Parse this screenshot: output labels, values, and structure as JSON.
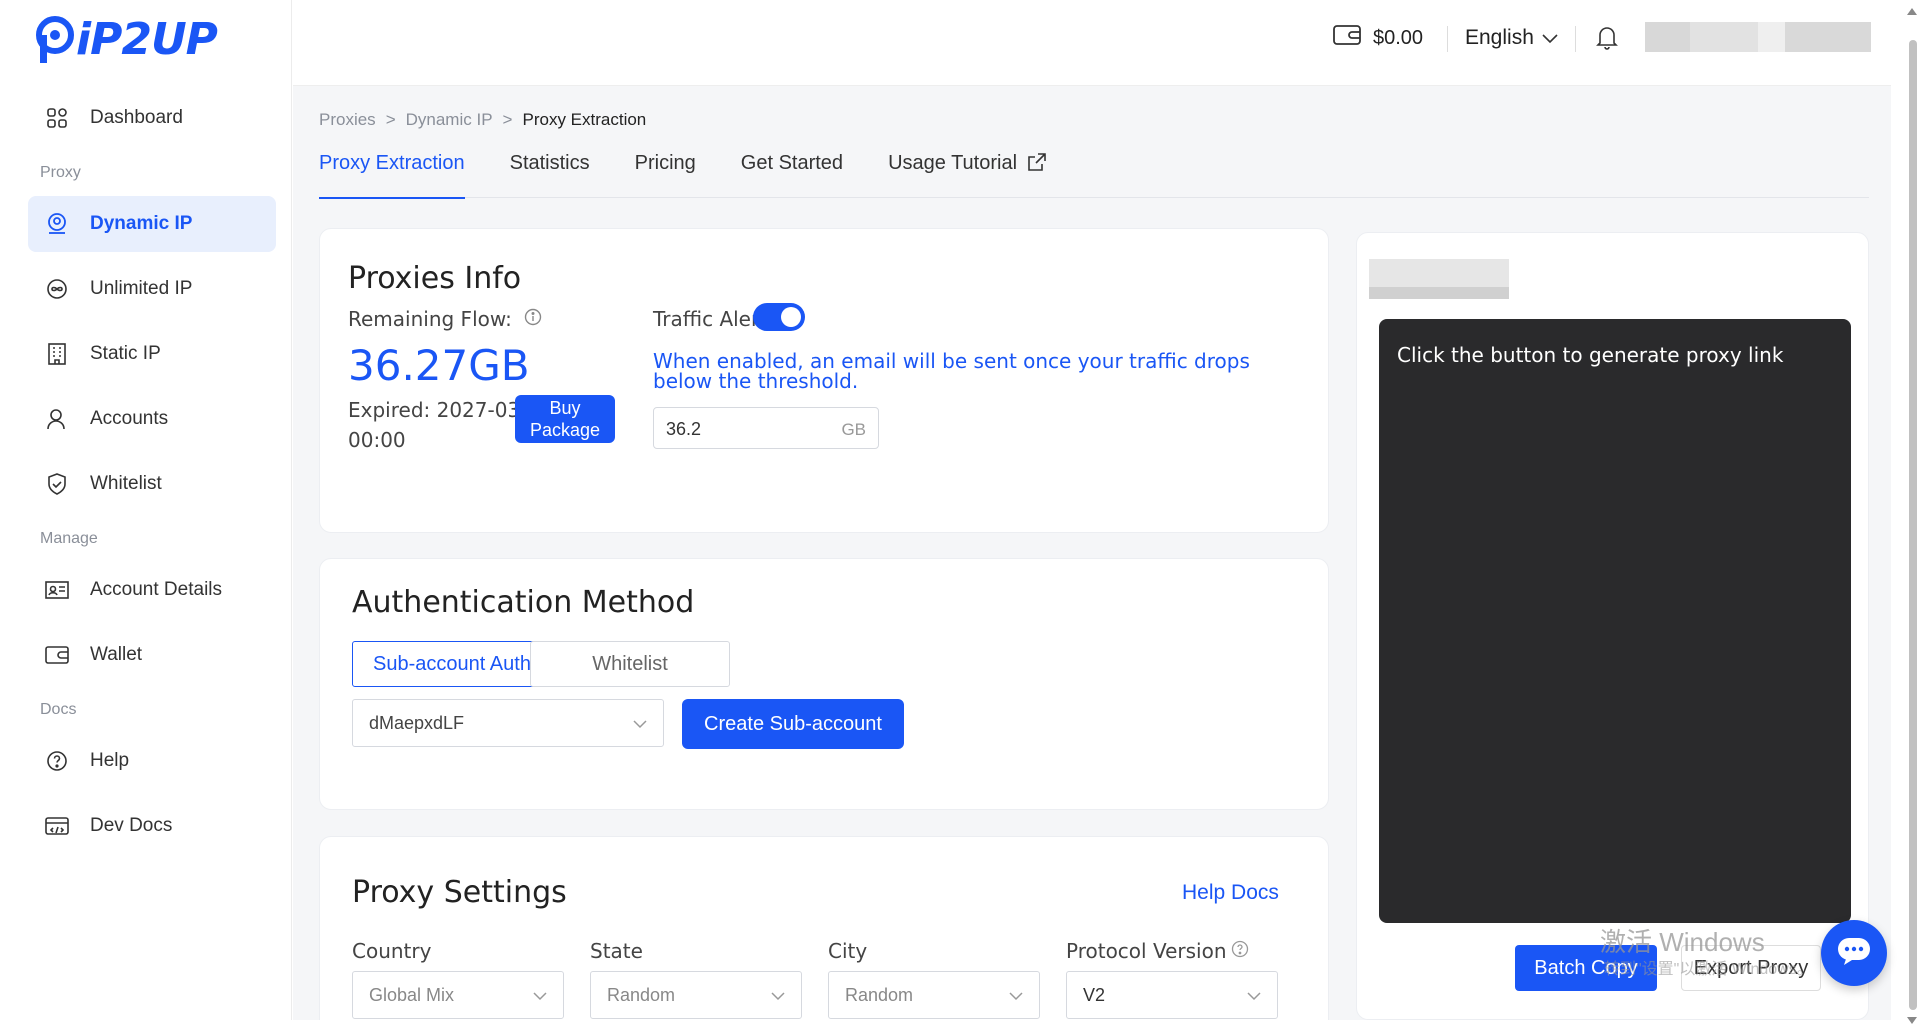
{
  "brand": {
    "logo_text": "iP2UP",
    "accent": "#1a56f5"
  },
  "sidebar": {
    "items_top": [
      {
        "label": "Dashboard",
        "icon": "dashboard-grid-icon"
      }
    ],
    "sections": [
      {
        "title": "Proxy",
        "items": [
          {
            "label": "Dynamic IP",
            "icon": "location-pin-icon",
            "active": true
          },
          {
            "label": "Unlimited IP",
            "icon": "infinity-icon"
          },
          {
            "label": "Static IP",
            "icon": "building-icon"
          },
          {
            "label": "Accounts",
            "icon": "user-icon"
          },
          {
            "label": "Whitelist",
            "icon": "shield-icon"
          }
        ]
      },
      {
        "title": "Manage",
        "items": [
          {
            "label": "Account Details",
            "icon": "id-card-icon"
          },
          {
            "label": "Wallet",
            "icon": "wallet-icon"
          }
        ]
      },
      {
        "title": "Docs",
        "items": [
          {
            "label": "Help",
            "icon": "help-circle-icon"
          },
          {
            "label": "Dev Docs",
            "icon": "code-doc-icon"
          }
        ]
      }
    ]
  },
  "topbar": {
    "balance": "$0.00",
    "language": "English"
  },
  "breadcrumb": {
    "items": [
      "Proxies",
      "Dynamic IP"
    ],
    "current": "Proxy Extraction",
    "sep": ">"
  },
  "tabs": [
    {
      "label": "Proxy Extraction",
      "active": true
    },
    {
      "label": "Statistics"
    },
    {
      "label": "Pricing"
    },
    {
      "label": "Get Started"
    },
    {
      "label": "Usage Tutorial",
      "external": true
    }
  ],
  "proxies_info": {
    "title": "Proxies Info",
    "remaining_label": "Remaining Flow:",
    "remaining_value": "36.27GB",
    "expired_line1": "Expired: 2027-03-31",
    "expired_line2": "00:00",
    "buy_button": "Buy Package",
    "traffic_alert_label": "Traffic Alert:",
    "traffic_alert_on": true,
    "alert_desc_line1": "When enabled, an email will be sent once your traffic drops",
    "alert_desc_line2": "below the threshold.",
    "threshold_value": "36.2",
    "threshold_unit": "GB"
  },
  "auth": {
    "title": "Authentication Method",
    "options": [
      "Sub-account Auth",
      "Whitelist"
    ],
    "selected_account": "dMaepxdLF",
    "create_button": "Create Sub-account"
  },
  "proxy_settings": {
    "title": "Proxy Settings",
    "help_link": "Help Docs",
    "fields": [
      {
        "label": "Country",
        "value": "Global Mix"
      },
      {
        "label": "State",
        "value": "Random"
      },
      {
        "label": "City",
        "value": "Random"
      },
      {
        "label": "Protocol Version",
        "value": "V2"
      }
    ]
  },
  "right_panel": {
    "terminal_text": "Click the button to generate proxy link",
    "batch_copy": "Batch Copy",
    "export_proxy": "Export Proxy"
  },
  "watermark": {
    "line1": "激活 Windows",
    "line2": "转到\"设置\"以激活 Windows。"
  }
}
